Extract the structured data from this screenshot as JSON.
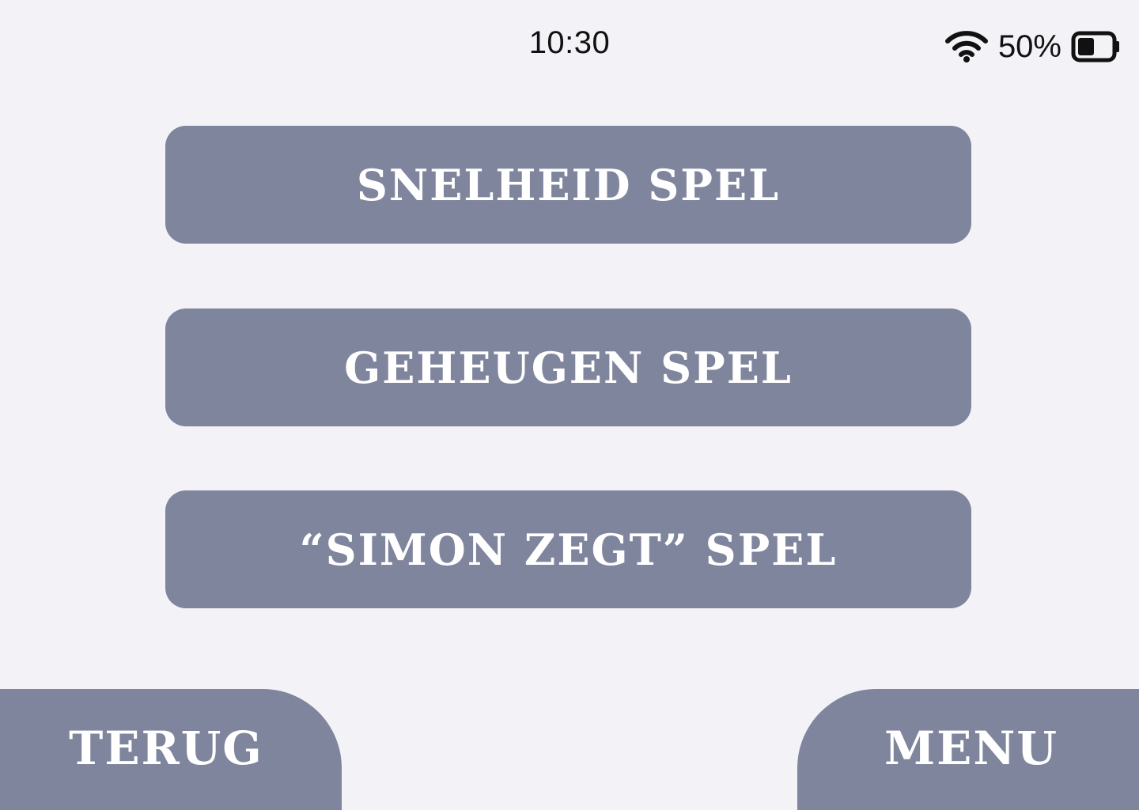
{
  "status_bar": {
    "time": "10:30",
    "battery_percent_text": "50%",
    "battery_level": 0.5,
    "wifi_icon": "wifi-icon",
    "battery_icon": "battery-icon"
  },
  "games": {
    "speed_label": "SNELHEID SPEL",
    "memory_label": "GEHEUGEN SPEL",
    "simon_label": "“SIMON ZEGT” SPEL"
  },
  "nav": {
    "back_label": "TERUG",
    "menu_label": "MENU"
  },
  "colors": {
    "background": "#f2f2f7",
    "button": "#80859e",
    "button_text": "#ffffff",
    "status_text": "#111111"
  }
}
